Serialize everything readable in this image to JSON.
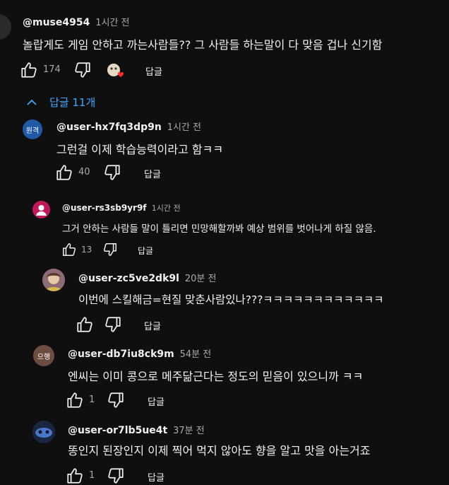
{
  "root": {
    "author": "@muse4954",
    "time": "1시간 전",
    "text": "놀랍게도 게임 안하고 까는사람들?? 그 사람들 하는말이 다 맞음 겁나 신기함",
    "likes": "174",
    "reply_label": "답글"
  },
  "replies_toggle": {
    "label": "답글 11개"
  },
  "replies": [
    {
      "author": "@user-hx7fq3dp9n",
      "time": "1시간 전",
      "text": "그런걸 이제 학습능력이라고 함ㅋㅋ",
      "likes": "40",
      "reply_label": "답글",
      "avatar_text": "원격",
      "avatar_color": "#1f5aa6"
    },
    {
      "author": "@user-rs3sb9yr9f",
      "time": "1시간 전",
      "text": "그거 안하는 사람들 말이 틀리면 민망해할까봐 예상 범위를 벗어나게 하질 않음.",
      "likes": "13",
      "reply_label": "답글",
      "avatar_color": "#c2185b"
    },
    {
      "author": "@user-zc5ve2dk9l",
      "time": "20분 전",
      "text": "이번에 스킬해금=현질 맞춘사람있나???ㅋㅋㅋㅋㅋㅋㅋㅋㅋㅋㅋㅋ",
      "likes": "",
      "reply_label": "답글"
    },
    {
      "author": "@user-db7iu8ck9m",
      "time": "54분 전",
      "text": "엔씨는 이미 콩으로 메주닮근다는 정도의 믿음이 있으니까 ㅋㅋ",
      "likes": "1",
      "reply_label": "답글",
      "avatar_text": "으행",
      "avatar_color": "#6d4c41"
    },
    {
      "author": "@user-or7lb5ue4t",
      "time": "37분 전",
      "text": "똥인지 된장인지 이제 찍어 먹지 않아도 향을 알고 맛을 아는거죠",
      "likes": "1",
      "reply_label": "답글"
    }
  ]
}
